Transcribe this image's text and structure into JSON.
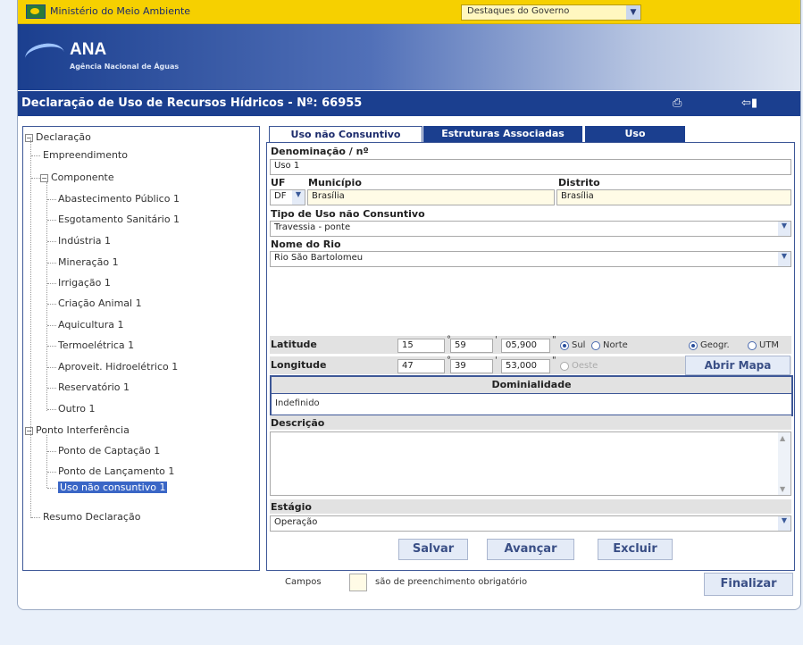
{
  "header": {
    "ministry": "Ministério do Meio Ambiente",
    "gov_select": "Destaques do Governo",
    "ana_title": "ANA",
    "ana_subtitle": "Agência Nacional de Águas",
    "page_title": "Declaração de Uso de Recursos Hídricos - Nº: 66955"
  },
  "tree": {
    "root": "Declaração",
    "empreendimento": "Empreendimento",
    "componente": "Componente",
    "componentes": [
      "Abastecimento Público 1",
      "Esgotamento Sanitário 1",
      "Indústria 1",
      "Mineração 1",
      "Irrigação 1",
      "Criação Animal 1",
      "Aquicultura 1",
      "Termoelétrica 1",
      "Aproveit. Hidroelétrico 1",
      "Reservatório 1",
      "Outro 1"
    ],
    "ponto": "Ponto Interferência",
    "pontos": [
      "Ponto de Captação 1",
      "Ponto de Lançamento 1",
      "Uso não consuntivo 1"
    ],
    "resumo": "Resumo Declaração"
  },
  "tabs": [
    "Uso não Consuntivo",
    "Estruturas Associadas",
    "Uso"
  ],
  "form": {
    "denominacao_label": "Denominação / nº",
    "denominacao_value": "Uso 1",
    "uf_label": "UF",
    "uf_value": "DF",
    "municipio_label": "Município",
    "municipio_value": "Brasília",
    "distrito_label": "Distrito",
    "distrito_value": "Brasília",
    "tipo_label": "Tipo de Uso não Consuntivo",
    "tipo_value": "Travessia - ponte",
    "rio_label": "Nome do Rio",
    "rio_value": "Rio São Bartolomeu",
    "lat_label": "Latitude",
    "lat_deg": "15",
    "lat_min": "59",
    "lat_sec": "05,900",
    "sul": "Sul",
    "norte": "Norte",
    "geogr": "Geogr.",
    "utm": "UTM",
    "lon_label": "Longitude",
    "lon_deg": "47",
    "lon_min": "39",
    "lon_sec": "53,000",
    "oeste": "Oeste",
    "abrir_mapa": "Abrir Mapa",
    "dominialidade_label": "Dominialidade",
    "dominialidade_value": "Indefinido",
    "descricao_label": "Descrição",
    "estagio_label": "Estágio",
    "estagio_value": "Operação"
  },
  "buttons": {
    "salvar": "Salvar",
    "avancar": "Avançar",
    "excluir": "Excluir",
    "finalizar": "Finalizar"
  },
  "footer": {
    "campos": "Campos",
    "obrigatorio": "são de preenchimento obrigatório"
  }
}
